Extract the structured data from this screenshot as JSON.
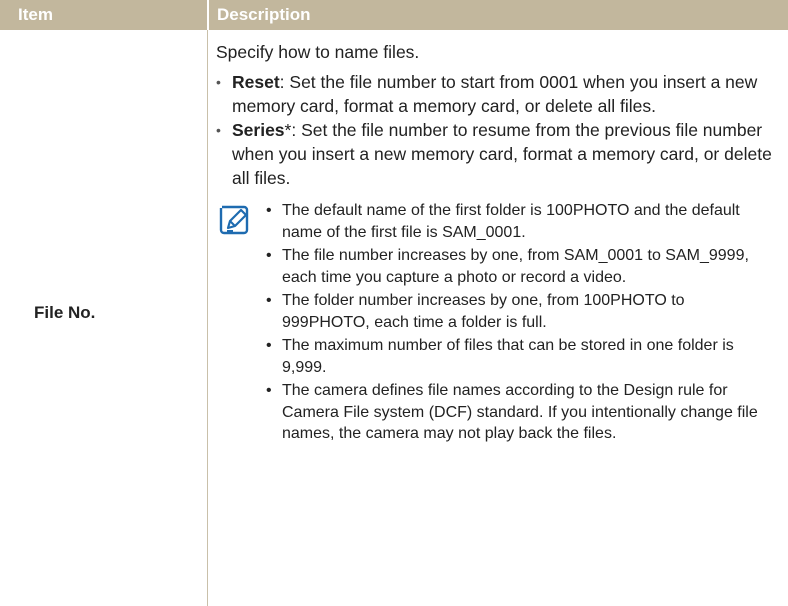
{
  "header": {
    "item": "Item",
    "description": "Description"
  },
  "row": {
    "item_label": "File No.",
    "intro": "Specify how to name files.",
    "options": [
      {
        "term": "Reset",
        "asterisk": "",
        "text": ": Set the file number to start from 0001 when you insert a new memory card, format a memory card, or delete all files."
      },
      {
        "term": "Series",
        "asterisk": "*",
        "text": ": Set the file number to resume from the previous file number when you insert a new memory card, format a memory card, or delete all files."
      }
    ],
    "notes": [
      "The default name of the first folder is 100PHOTO and the default name of the first file is SAM_0001.",
      "The file number increases by one, from SAM_0001 to SAM_9999, each time you capture a photo or record a video.",
      "The folder number increases by one, from 100PHOTO to 999PHOTO, each time a folder is full.",
      "The maximum number of files that can be stored in one folder is 9,999.",
      "The camera defines file names according to the Design rule for Camera File system (DCF) standard. If you intentionally change file names, the camera may not play back the files."
    ],
    "note_icon": "note-pencil-icon"
  },
  "colors": {
    "header_bg": "#c2b79d",
    "note_icon": "#1e6bb0"
  }
}
